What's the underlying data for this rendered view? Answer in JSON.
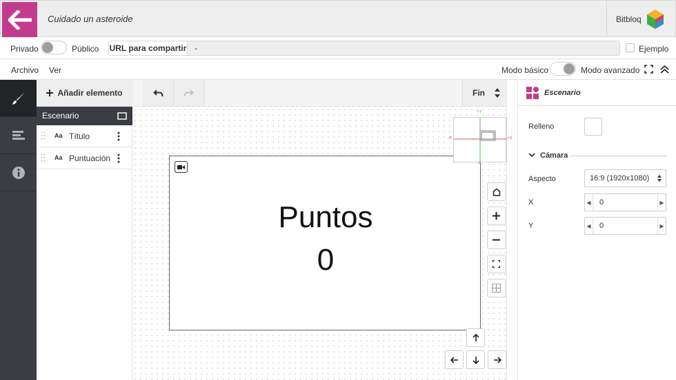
{
  "header": {
    "title": "Cuidado un asteroide",
    "brand": "Bitbloq",
    "accent_color": "#c23c8e"
  },
  "share": {
    "private_label": "Privado",
    "public_label": "Público",
    "url_label": "URL para compartir",
    "url_value": "-",
    "example_label": "Ejemplo"
  },
  "menu": {
    "items": [
      "Archivo",
      "Ver"
    ],
    "mode_basic": "Modo básico",
    "mode_advanced": "Modo avanzado"
  },
  "elements": {
    "add_label": "Añadir elemento",
    "scene_label": "Escenario",
    "items": [
      {
        "type": "Aa",
        "name": "Título"
      },
      {
        "type": "Aa",
        "name": "Puntuación"
      }
    ]
  },
  "toolbar": {
    "end_label": "Fin"
  },
  "stage": {
    "title": "Puntos",
    "score": "0"
  },
  "minimap": {
    "x_neg": "-X",
    "x_pos": "+X",
    "y_pos": "+Y",
    "y_neg": "-Y"
  },
  "properties": {
    "title": "Escenario",
    "fill_label": "Relleno",
    "camera_section": "Cámara",
    "aspect_label": "Aspecto",
    "aspect_value": "16:9 (1920x1080)",
    "x_label": "X",
    "x_value": "0",
    "y_label": "Y",
    "y_value": "0"
  }
}
